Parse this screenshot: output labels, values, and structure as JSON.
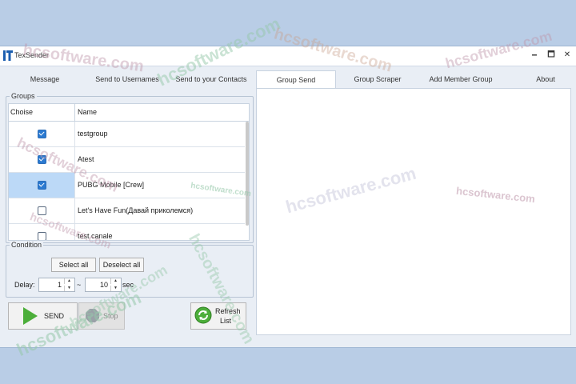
{
  "app": {
    "title": "TexSender",
    "window_buttons": {
      "minimize": "🗕",
      "maximize": "🗖",
      "close": "✕"
    }
  },
  "tabs": [
    {
      "label": "Message"
    },
    {
      "label": "Send to Usernames"
    },
    {
      "label": "Send to your Contacts"
    },
    {
      "label": "Group Send",
      "active": true
    },
    {
      "label": "Group Scraper"
    },
    {
      "label": "Add Member Group"
    },
    {
      "label": "About"
    }
  ],
  "groups": {
    "legend": "Groups",
    "columns": {
      "choise": "Choise",
      "name": "Name"
    },
    "rows": [
      {
        "name": "testgroup",
        "checked": true,
        "selected": false
      },
      {
        "name": "Atest",
        "checked": true,
        "selected": false
      },
      {
        "name": "PUBG Mobile [Crew]",
        "checked": true,
        "selected": true
      },
      {
        "name": "Let's Have Fun(Давай приколемся)",
        "checked": false,
        "selected": false
      },
      {
        "name": "test canale",
        "checked": false,
        "selected": false
      }
    ]
  },
  "condition": {
    "legend": "Condition",
    "select_all": "Select all",
    "deselect_all": "Deselect all",
    "delay_label": "Delay:",
    "delay_min": "1",
    "delay_separator": "~",
    "delay_max": "10",
    "delay_unit": "sec"
  },
  "actions": {
    "send": "SEND",
    "stop": "Stop",
    "refresh_line1": "Refresh",
    "refresh_line2": "List"
  },
  "watermarks": [
    "hcsoftware.com",
    "hcsoftware.com",
    "hcsoftware.com",
    "hcsoftware.com",
    "hcsoftware.com",
    "hcsoftware.com",
    "hcsoftware.com",
    "hcsoftware.com",
    "hcsoftware.com",
    "hcsoftware.com",
    "hcsoftware.com",
    "hcsoftware.com"
  ],
  "colors": {
    "accent": "#2b7ad1",
    "selection": "#bcd9f7",
    "play": "#4cae3a",
    "refresh": "#4cae3a",
    "background": "#b9cde6"
  }
}
